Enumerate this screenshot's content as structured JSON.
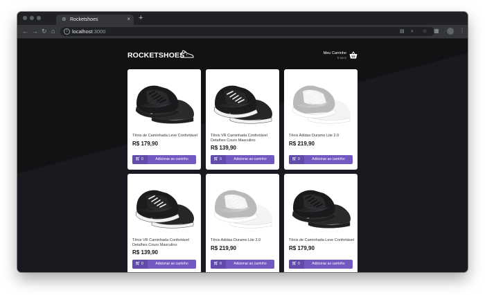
{
  "browser": {
    "tab_title": "Rocketshoes",
    "tab_close": "×",
    "new_tab": "+",
    "url_host": "localhost",
    "url_port": ":3000"
  },
  "header": {
    "logo": "ROCKETSHOES",
    "cart_title": "Meu Carrinho",
    "cart_count": "0 itens"
  },
  "products": [
    {
      "title": "Tênis de Caminhada Leve Confortável",
      "price": "R$ 179,90",
      "amount": "0",
      "button": "Adicionar ao carrinho",
      "shoe_color": "black"
    },
    {
      "title": "Tênis VR Caminhada Confortável Detalhes Couro Masculino",
      "price": "R$ 139,90",
      "amount": "0",
      "button": "Adicionar ao carrinho",
      "shoe_color": "black-white"
    },
    {
      "title": "Tênis Adidas Duramo Lite 2.0",
      "price": "R$ 219,90",
      "amount": "0",
      "button": "Adicionar ao carrinho",
      "shoe_color": "white-grey"
    },
    {
      "title": "Tênis VR Caminhada Confortável Detalhes Couro Masculino",
      "price": "R$ 139,90",
      "amount": "0",
      "button": "Adicionar ao carrinho",
      "shoe_color": "black-white"
    },
    {
      "title": "Tênis Adidas Duramo Lite 2.0",
      "price": "R$ 219,90",
      "amount": "0",
      "button": "Adicionar ao carrinho",
      "shoe_color": "white-grey"
    },
    {
      "title": "Tênis de Caminhada Leve Confortável",
      "price": "R$ 179,90",
      "amount": "0",
      "button": "Adicionar ao carrinho",
      "shoe_color": "black"
    }
  ],
  "colors": {
    "accent": "#7159c1",
    "accent_dark": "#624cab",
    "page_bg": "#191920"
  }
}
